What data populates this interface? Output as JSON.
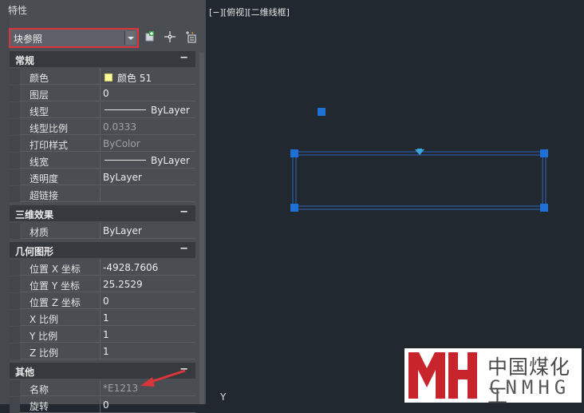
{
  "panel": {
    "title": "特性",
    "object_selector": {
      "value": "块参照"
    },
    "toolbar": [
      "toggle-pickadd-icon",
      "select-objects-icon",
      "quick-select-icon"
    ],
    "sections": {
      "general": {
        "label": "常规",
        "toggle": "−",
        "rows": [
          {
            "name": "颜色",
            "value": "颜色 51",
            "swatch": "#ffff99"
          },
          {
            "name": "图层",
            "value": "0"
          },
          {
            "name": "线型",
            "value": "ByLayer"
          },
          {
            "name": "线型比例",
            "value": "0.0333"
          },
          {
            "name": "打印样式",
            "value": "ByColor"
          },
          {
            "name": "线宽",
            "value": "ByLayer"
          },
          {
            "name": "透明度",
            "value": "ByLayer"
          },
          {
            "name": "超链接",
            "value": ""
          }
        ]
      },
      "three_d": {
        "label": "三维效果",
        "toggle": "−",
        "rows": [
          {
            "name": "材质",
            "value": "ByLayer"
          }
        ]
      },
      "geometry": {
        "label": "几何图形",
        "toggle": "−",
        "rows": [
          {
            "name": "位置 X 坐标",
            "value": "-4928.7606"
          },
          {
            "name": "位置 Y 坐标",
            "value": "25.2529"
          },
          {
            "name": "位置 Z 坐标",
            "value": "0"
          },
          {
            "name": "X 比例",
            "value": "1"
          },
          {
            "name": "Y 比例",
            "value": "1"
          },
          {
            "name": "Z 比例",
            "value": "1"
          }
        ]
      },
      "misc": {
        "label": "其他",
        "toggle": "−",
        "rows": [
          {
            "name": "名称",
            "value": "*E1213"
          },
          {
            "name": "旋转",
            "value": "0"
          }
        ]
      }
    }
  },
  "viewport": {
    "label": "[−][俯视][二维线框]",
    "ucs_label": "Y",
    "grip_color": "#1e6fd6",
    "line_color": "#2f63b8"
  },
  "watermark": {
    "chinese": "中国煤化工",
    "english": "CNMHG",
    "brand_color": "#c8242b"
  },
  "annotation": {
    "arrow_color": "#d9353a"
  }
}
